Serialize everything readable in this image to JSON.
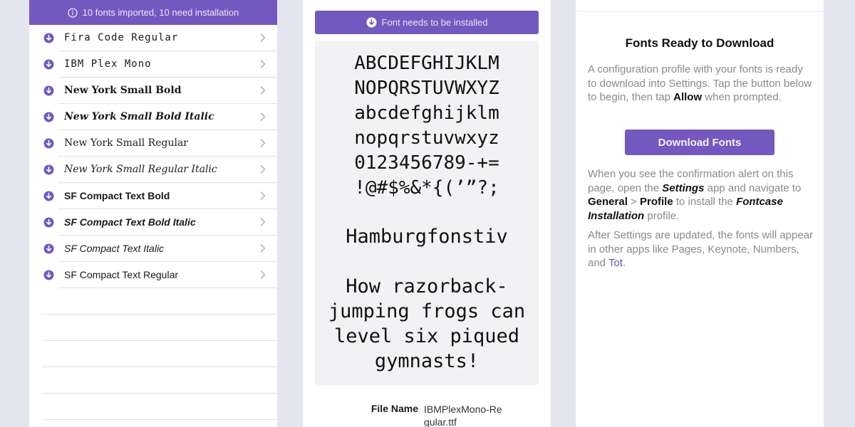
{
  "left": {
    "banner_text": "10 fonts imported, 10 need installation",
    "fonts": [
      {
        "name": "Fira Code Regular",
        "style": "ff-mono"
      },
      {
        "name": "IBM Plex Mono",
        "style": "ff-mono"
      },
      {
        "name": "New York Small Bold",
        "style": "ff-serif-b"
      },
      {
        "name": "New York Small Bold Italic",
        "style": "ff-serif-bi"
      },
      {
        "name": "New York Small Regular",
        "style": "ff-serif"
      },
      {
        "name": "New York Small Regular Italic",
        "style": "ff-serif-i"
      },
      {
        "name": "SF Compact Text Bold",
        "style": "ff-sans-b"
      },
      {
        "name": "SF Compact Text Bold Italic",
        "style": "ff-sans-bi"
      },
      {
        "name": "SF Compact Text Italic",
        "style": "ff-sans-i"
      },
      {
        "name": "SF Compact Text Regular",
        "style": "ff-sans"
      }
    ]
  },
  "middle": {
    "install_label": "Font needs to be installed",
    "glyph_lines": [
      "ABCDEFGHIJKLM",
      "NOPQRSTUVWXYZ",
      "abcdefghijklm",
      "nopqrstuvwxyz",
      "0123456789-+=",
      "!@#$%&*{(’”?;"
    ],
    "sample_word": "Hamburgfonstiv",
    "pangram": "How razorback-jumping frogs can level six piqued gymnasts!",
    "file_name_label": "File Name",
    "file_name_value": "IBMPlexMono-Regular.ttf"
  },
  "right": {
    "title": "Fonts Ready to Download",
    "para1_a": "A configuration profile with your fonts is ready to download into Settings. Tap the button below to begin, then tap ",
    "para1_allow": "Allow",
    "para1_b": " when prompted.",
    "download_button": "Download Fonts",
    "para2_a": "When you see the confirmation alert on this page, open the ",
    "para2_settings": "Settings",
    "para2_b": " app and navigate to ",
    "para2_general": "General",
    "para2_sep": " > ",
    "para2_profile": "Profile",
    "para2_c": " to install the ",
    "para2_fontcase": "Fontcase Installation",
    "para2_d": " profile.",
    "para3_a": "After Settings are updated, the fonts will appear in other apps like Pages, Keynote, Numbers, and ",
    "para3_tot": "Tot",
    "para3_b": "."
  },
  "colors": {
    "accent": "#7458bf",
    "background": "#e4e5ee",
    "link": "#6a4fb8"
  },
  "icons": {
    "banner": "info-icon",
    "row": "download-circle-icon",
    "row_disclosure": "chevron-right-icon"
  }
}
